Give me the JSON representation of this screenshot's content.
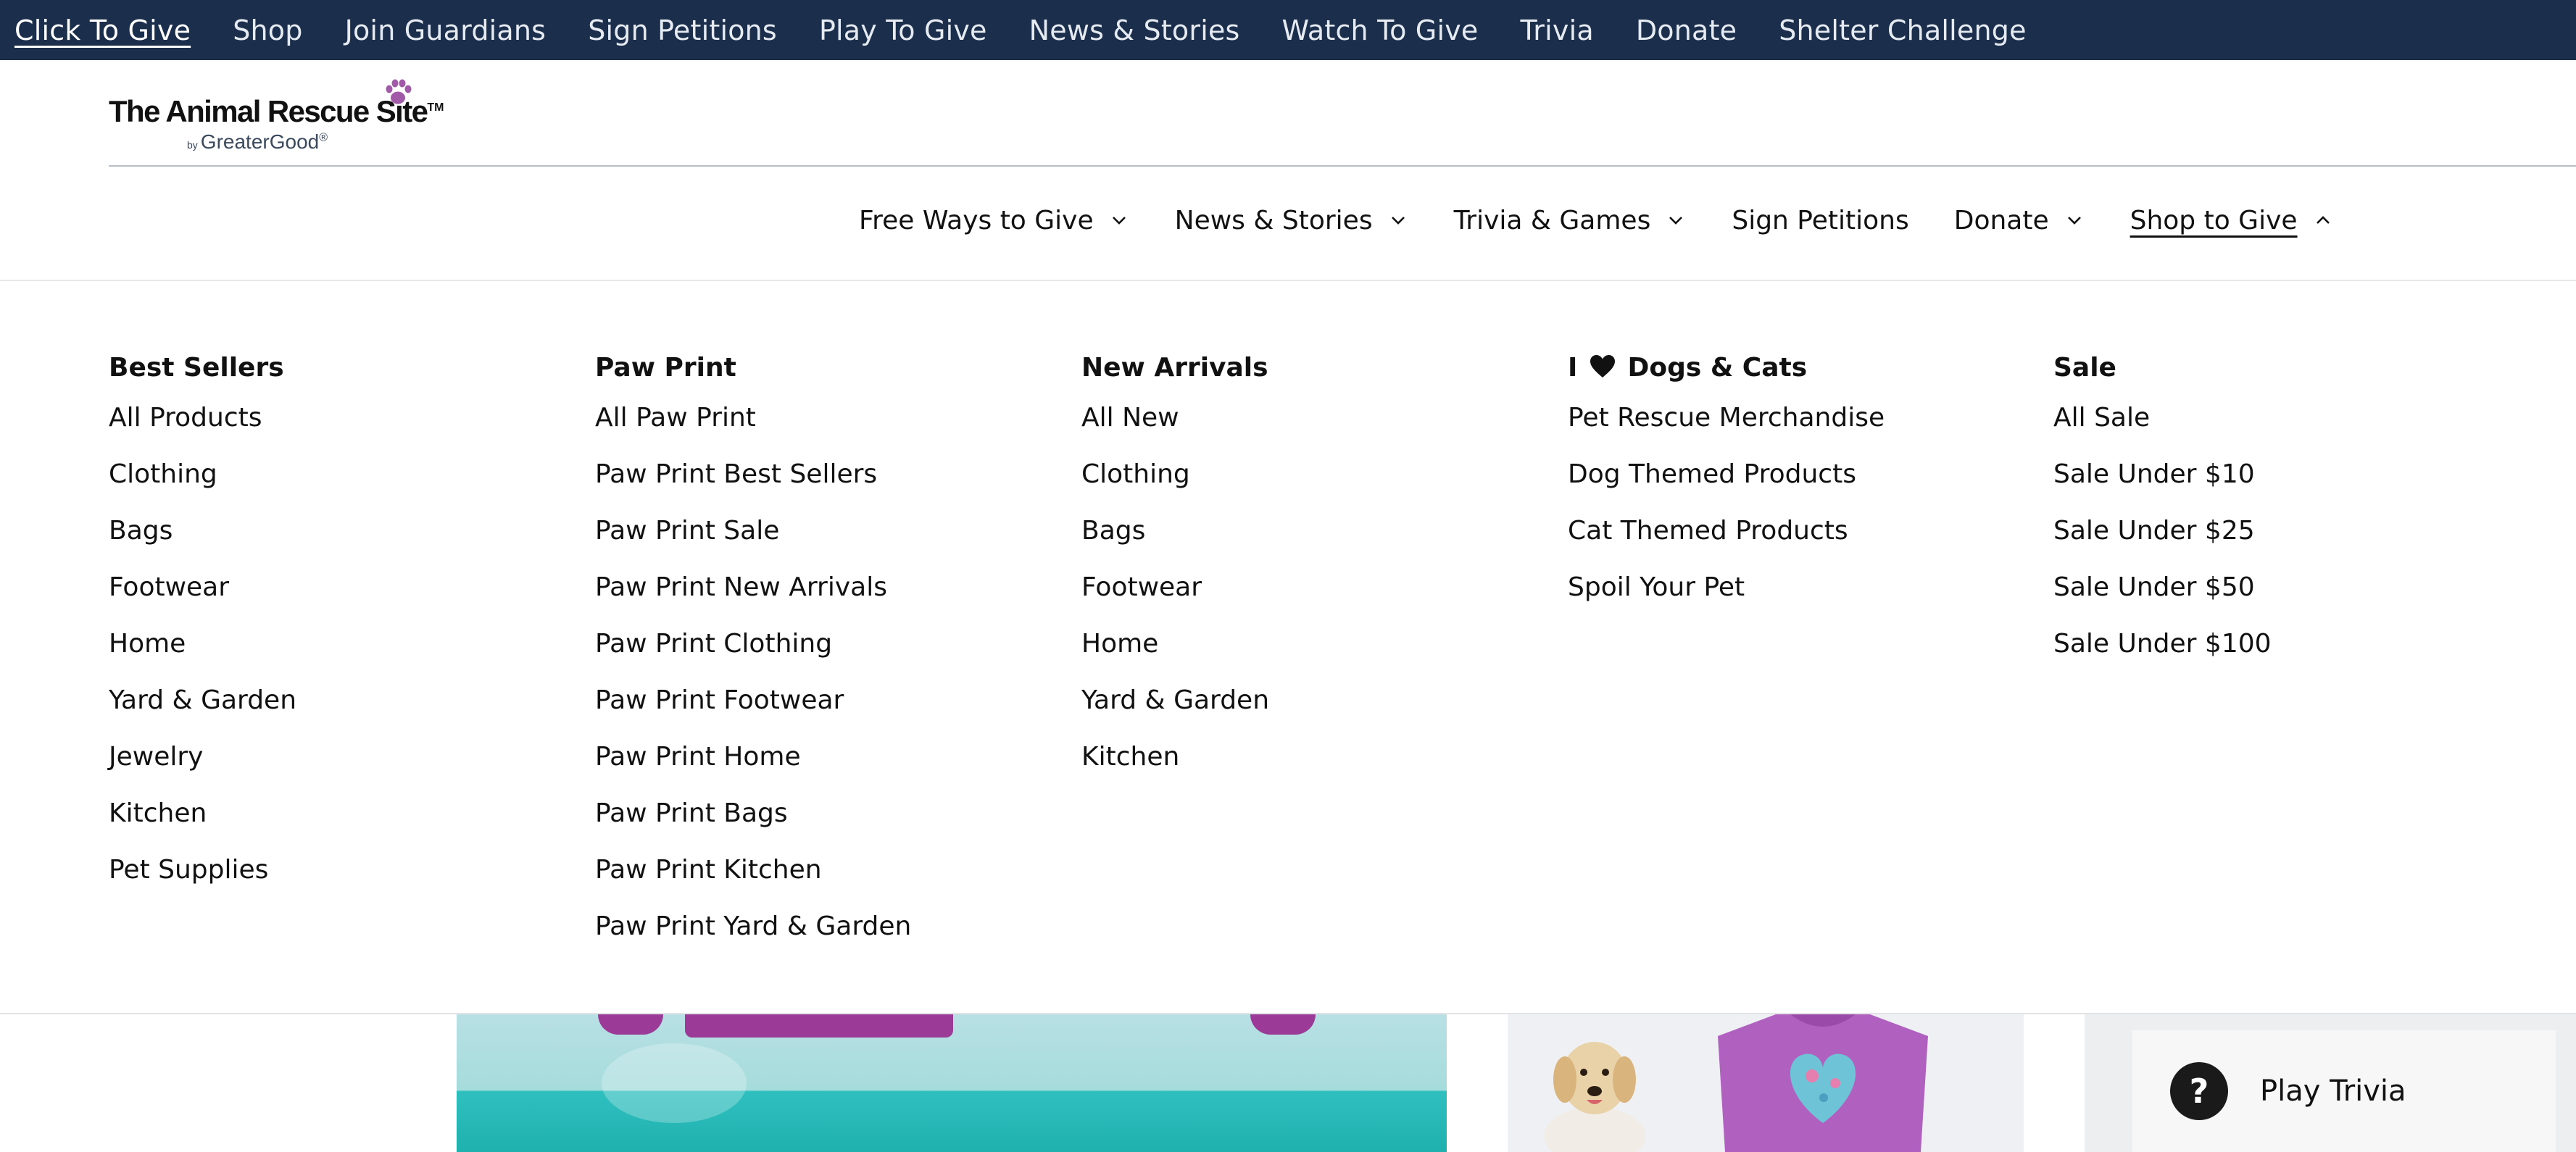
{
  "topbar": {
    "links": [
      "Click To Give",
      "Shop",
      "Join Guardians",
      "Sign Petitions",
      "Play To Give",
      "News & Stories",
      "Watch To Give",
      "Trivia",
      "Donate",
      "Shelter Challenge"
    ],
    "active": "Click To Give"
  },
  "logo": {
    "name": "The Animal Rescue Site",
    "tm": "TM",
    "by": "by",
    "brand": "GreaterGood",
    "reg": "®"
  },
  "mainnav": {
    "items": [
      {
        "label": "Free Ways to Give",
        "chevron": "down"
      },
      {
        "label": "News & Stories",
        "chevron": "down"
      },
      {
        "label": "Trivia & Games",
        "chevron": "down"
      },
      {
        "label": "Sign Petitions",
        "chevron": "none"
      },
      {
        "label": "Donate",
        "chevron": "down"
      },
      {
        "label": "Shop to Give",
        "chevron": "up",
        "active": true
      }
    ]
  },
  "megamenu": {
    "columns": [
      {
        "heading": "Best Sellers",
        "items": [
          "All Products",
          "Clothing",
          "Bags",
          "Footwear",
          "Home",
          "Yard & Garden",
          "Jewelry",
          "Kitchen",
          "Pet Supplies"
        ]
      },
      {
        "heading": "Paw Print",
        "items": [
          "All Paw Print",
          "Paw Print Best Sellers",
          "Paw Print Sale",
          "Paw Print New Arrivals",
          "Paw Print Clothing",
          "Paw Print Footwear",
          "Paw Print Home",
          "Paw Print Bags",
          "Paw Print Kitchen",
          "Paw Print Yard & Garden"
        ]
      },
      {
        "heading": "New Arrivals",
        "items": [
          "All New",
          "Clothing",
          "Bags",
          "Footwear",
          "Home",
          "Yard & Garden",
          "Kitchen"
        ]
      },
      {
        "heading_pre": "I",
        "heading_post": "Dogs & Cats",
        "heading_icon": "heart-icon",
        "items": [
          "Pet Rescue Merchandise",
          "Dog Themed Products",
          "Cat Themed Products",
          "Spoil Your Pet"
        ]
      },
      {
        "heading": "Sale",
        "items": [
          "All Sale",
          "Sale Under $10",
          "Sale Under $25",
          "Sale Under $50",
          "Sale Under $100"
        ]
      }
    ]
  },
  "trivia": {
    "icon": "question-icon",
    "glyph": "?",
    "label": "Play Trivia"
  },
  "colors": {
    "topbar": "#1b2e4b",
    "brand_purple": "#9b3a97",
    "paw": "#a05aa8"
  }
}
